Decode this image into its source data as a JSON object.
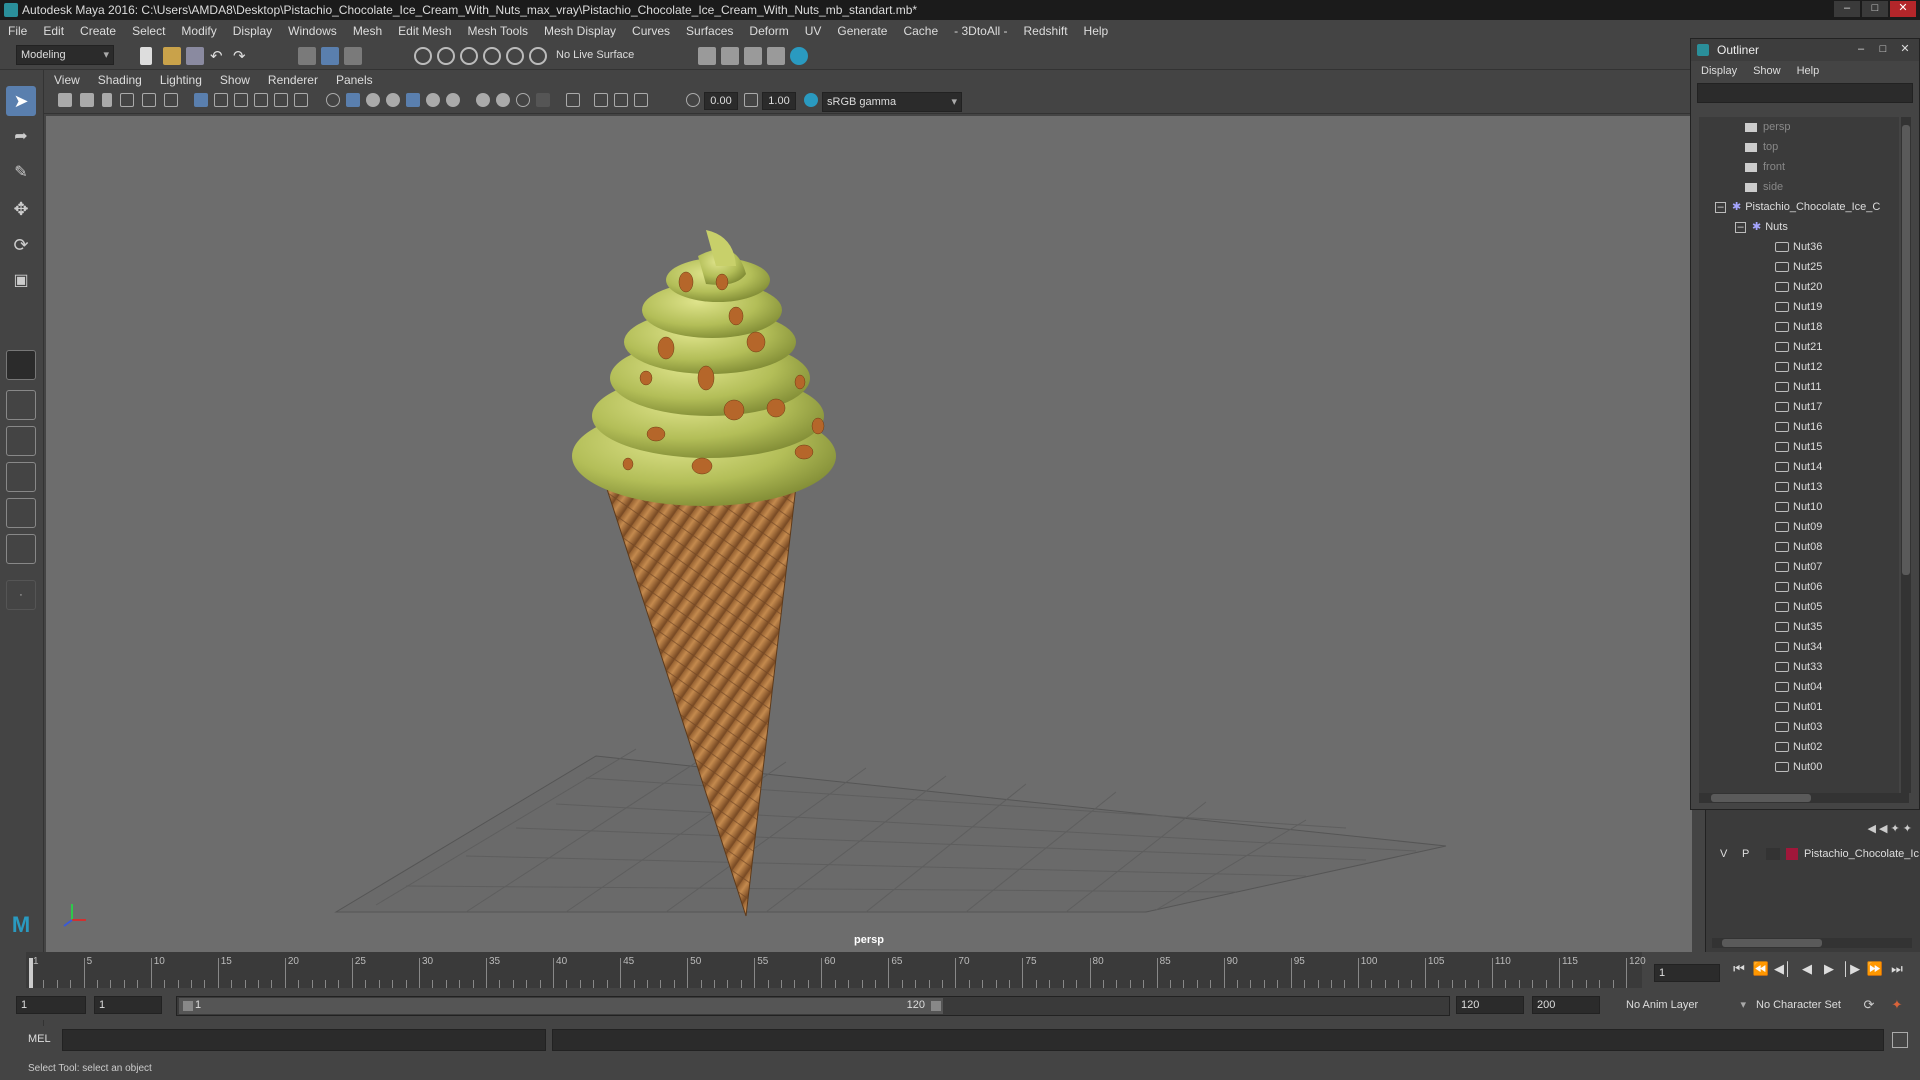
{
  "window": {
    "title": "Autodesk Maya 2016: C:\\Users\\AMDA8\\Desktop\\Pistachio_Chocolate_Ice_Cream_With_Nuts_max_vray\\Pistachio_Chocolate_Ice_Cream_With_Nuts_mb_standart.mb*"
  },
  "menubar": [
    "File",
    "Edit",
    "Create",
    "Select",
    "Modify",
    "Display",
    "Windows",
    "Mesh",
    "Edit Mesh",
    "Mesh Tools",
    "Mesh Display",
    "Curves",
    "Surfaces",
    "Deform",
    "UV",
    "Generate",
    "Cache",
    "- 3DtoAll -",
    "Redshift",
    "Help"
  ],
  "shelf": {
    "workspace": "Modeling",
    "live_surface": "No Live Surface"
  },
  "panel_menu": [
    "View",
    "Shading",
    "Lighting",
    "Show",
    "Renderer",
    "Panels"
  ],
  "panel_tools": {
    "exposure": "0.00",
    "gamma": "1.00",
    "color_space": "sRGB gamma"
  },
  "viewport": {
    "camera_label": "persp"
  },
  "outliner": {
    "title": "Outliner",
    "menu": [
      "Display",
      "Show",
      "Help"
    ],
    "cameras": [
      "persp",
      "top",
      "front",
      "side"
    ],
    "root_group": "Pistachio_Chocolate_Ice_C",
    "sub_group": "Nuts",
    "nuts": [
      "Nut36",
      "Nut25",
      "Nut20",
      "Nut19",
      "Nut18",
      "Nut21",
      "Nut12",
      "Nut11",
      "Nut17",
      "Nut16",
      "Nut15",
      "Nut14",
      "Nut13",
      "Nut10",
      "Nut09",
      "Nut08",
      "Nut07",
      "Nut06",
      "Nut05",
      "Nut35",
      "Nut34",
      "Nut33",
      "Nut04",
      "Nut01",
      "Nut03",
      "Nut02",
      "Nut00"
    ]
  },
  "layers": {
    "v": "V",
    "p": "P",
    "layer_name": "Pistachio_Chocolate_Ic",
    "layer_color": "#a0173a"
  },
  "timeline": {
    "ticks": [
      "1",
      "5",
      "10",
      "15",
      "20",
      "25",
      "30",
      "35",
      "40",
      "45",
      "50",
      "55",
      "60",
      "65",
      "70",
      "75",
      "80",
      "85",
      "90",
      "95",
      "100",
      "105",
      "110",
      "115",
      "120"
    ],
    "current_frame": "1"
  },
  "range": {
    "start": "1",
    "inner_start": "1",
    "slider_start": "1",
    "slider_end": "120",
    "end": "120",
    "max": "200",
    "anim_layer": "No Anim Layer",
    "character_set": "No Character Set"
  },
  "cmdline": {
    "label": "MEL"
  },
  "helpline": {
    "text": "Select Tool: select an object"
  },
  "colors": {
    "accent": "#2a8f9a",
    "viewport_bg": "#6d6d6d",
    "icecream": "#b6c15a",
    "cone": "#b87a40"
  }
}
